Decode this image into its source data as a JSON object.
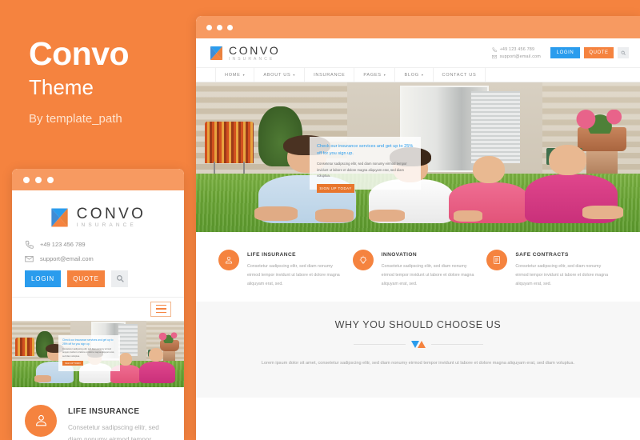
{
  "promo": {
    "title": "Convo",
    "subtitle": "Theme",
    "byline": "By template_path"
  },
  "colors": {
    "background": "#f5833f",
    "titlebar": "#f79a61",
    "accent_orange": "#f5833f",
    "accent_blue": "#2a9ced",
    "button_orange": "#e8762d",
    "heading": "#4a4a4a",
    "body_text": "#a3a3a3"
  },
  "site": {
    "logo": {
      "name": "CONVO",
      "tagline": "INSURANCE"
    },
    "contact": {
      "phone": "+49 123 456 789",
      "email": "support@email.com",
      "phone_icon": "phone-icon",
      "email_icon": "envelope-icon"
    },
    "buttons": {
      "login": "LOGIN",
      "quote": "QUOTE",
      "search_icon": "search-icon"
    },
    "nav": [
      {
        "label": "HOME",
        "has_dropdown": true
      },
      {
        "label": "ABOUT US",
        "has_dropdown": true
      },
      {
        "label": "INSURANCE",
        "has_dropdown": false
      },
      {
        "label": "PAGES",
        "has_dropdown": true
      },
      {
        "label": "BLOG",
        "has_dropdown": true
      },
      {
        "label": "CONTACT US",
        "has_dropdown": false
      }
    ],
    "hero": {
      "photo_alt": "family-lying-on-grass-photo",
      "card_title": "Check our insurance services and get up to 25% off for you sign up.",
      "card_body": "Consetetur sadipscing elitr, sed diam nonumy eirmod tempor invidunt ut labore et dolore magna aliquyam erat, sed diam voluptua.",
      "card_button": "SIGN UP TODAY"
    },
    "features": [
      {
        "icon": "user-icon",
        "title": "LIFE INSURANCE",
        "body": "Consetetur sadipscing elitr, sed diam nonumy eirmod tempor invidunt ut labore et dolore magna aliquyam erat, sed."
      },
      {
        "icon": "lightbulb-icon",
        "title": "INNOVATION",
        "body": "Consetetur sadipscing elitr, sed diam nonumy eirmod tempor invidunt ut labore et dolore magna aliquyam erat, sed."
      },
      {
        "icon": "contract-icon",
        "title": "SAFE CONTRACTS",
        "body": "Consetetur sadipscing elitr, sed diam nonumy eirmod tempor invidunt ut labore et dolore magna aliquyam erat, sed."
      }
    ],
    "why": {
      "title": "WHY YOU SHOULD CHOOSE US",
      "divider_icon": "double-triangle-divider-icon",
      "body": "Lorem ipsum dolor sit amet, consetetur sadipscing elitr, sed diam nonumy eirmod tempor invidunt ut labore et dolore magna aliquyam erat, sed diam voluptua."
    }
  },
  "mobile": {
    "menu_icon": "hamburger-menu-icon",
    "feature": {
      "icon": "user-icon",
      "title": "LIFE INSURANCE",
      "body": "Consetetur sadipscing elitr, sed diam nonumy eirmod tempor"
    }
  },
  "window_dots": [
    "dot-1",
    "dot-2",
    "dot-3"
  ]
}
